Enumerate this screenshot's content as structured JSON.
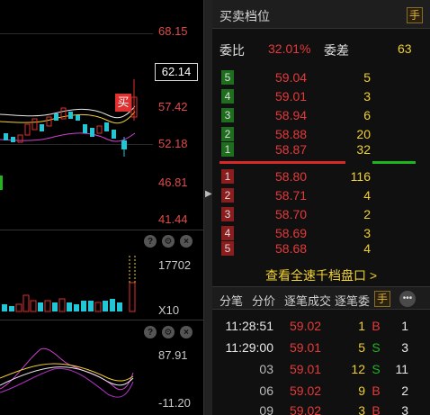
{
  "chart": {
    "price_ticks": [
      "68.15",
      "57.42",
      "52.18",
      "46.81",
      "41.44"
    ],
    "current_price": "62.14",
    "buy_marker": "买",
    "volume_max": "17702",
    "volume_unit": "X10",
    "indicator_ticks": [
      "87.91",
      "-11.20"
    ],
    "tools": {
      "help": "?",
      "settings": "⚙",
      "close": "×"
    },
    "colors": {
      "up": "#e03030",
      "down": "#21c7d6",
      "ma1": "#e8e8e8",
      "ma2": "#f0d030",
      "ma3": "#d040d0"
    }
  },
  "book": {
    "title": "买卖档位",
    "hand_label": "手",
    "weibi_label": "委比",
    "weibi_value": "32.01%",
    "weicha_label": "委差",
    "weicha_value": "63",
    "asks": [
      {
        "idx": "5",
        "price": "59.04",
        "vol": "5"
      },
      {
        "idx": "4",
        "price": "59.01",
        "vol": "3"
      },
      {
        "idx": "3",
        "price": "58.94",
        "vol": "6"
      },
      {
        "idx": "2",
        "price": "58.88",
        "vol": "20"
      },
      {
        "idx": "1",
        "price": "58.87",
        "vol": "32"
      }
    ],
    "bids": [
      {
        "idx": "1",
        "price": "58.80",
        "vol": "116"
      },
      {
        "idx": "2",
        "price": "58.71",
        "vol": "4"
      },
      {
        "idx": "3",
        "price": "58.70",
        "vol": "2"
      },
      {
        "idx": "4",
        "price": "58.69",
        "vol": "3"
      },
      {
        "idx": "5",
        "price": "58.68",
        "vol": "4"
      }
    ],
    "depth_link": "查看全速千档盘口 >"
  },
  "tabs": [
    "分笔",
    "分价",
    "逐笔成交",
    "逐笔委"
  ],
  "trades": [
    {
      "time": "11:28:51",
      "price": "59.02",
      "vol": "1",
      "dir": "B",
      "count": "1"
    },
    {
      "time": "11:29:00",
      "price": "59.01",
      "vol": "5",
      "dir": "S",
      "count": "3"
    },
    {
      "time": "03",
      "price": "59.01",
      "vol": "12",
      "dir": "S",
      "count": "11"
    },
    {
      "time": "06",
      "price": "59.02",
      "vol": "9",
      "dir": "B",
      "count": "2"
    },
    {
      "time": "09",
      "price": "59.02",
      "vol": "3",
      "dir": "B",
      "count": "3"
    }
  ]
}
